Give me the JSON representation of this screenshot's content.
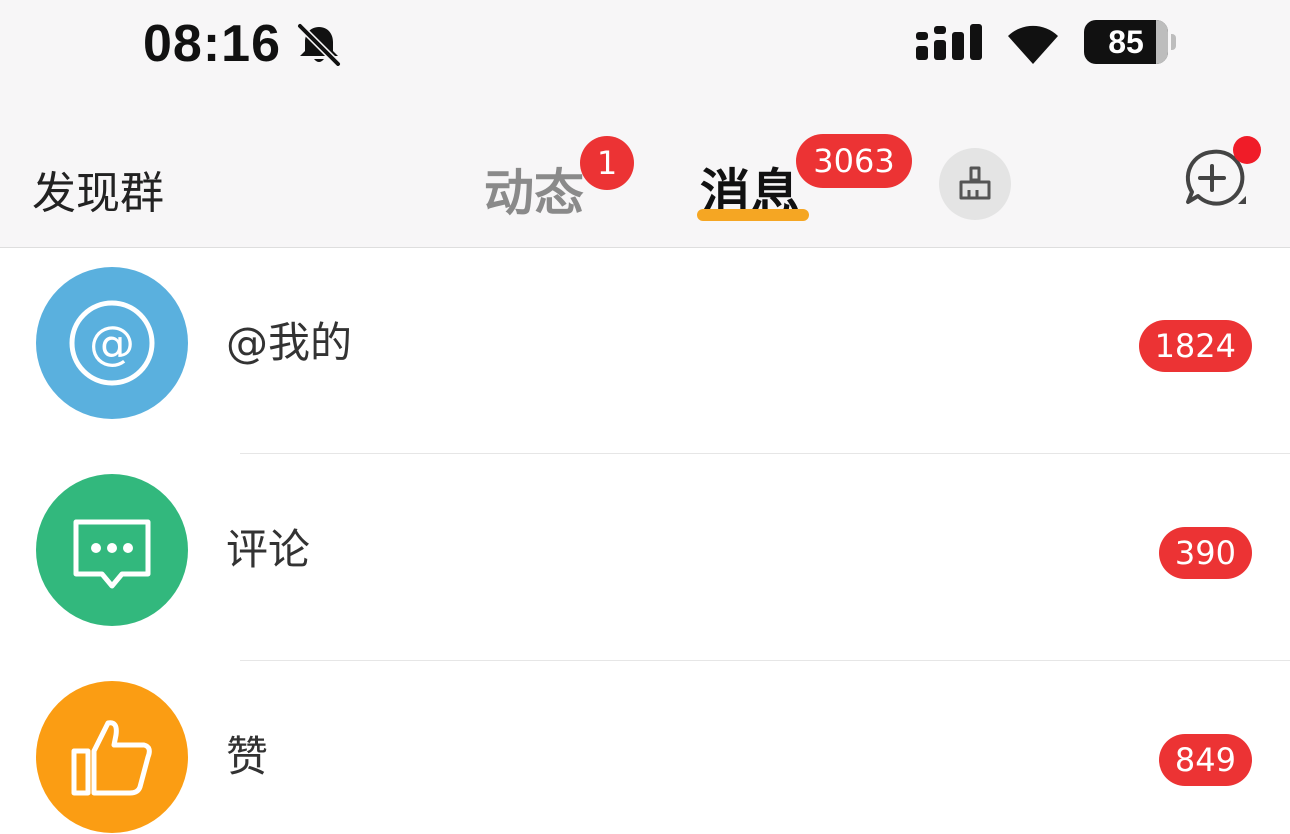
{
  "status_bar": {
    "time": "08:16",
    "icons": [
      "bell-slash-icon",
      "cellular-signal-icon",
      "wifi-icon",
      "battery-icon"
    ],
    "battery_level": "85"
  },
  "nav": {
    "left_label": "发现群",
    "tabs": [
      {
        "label": "动态",
        "badge": "1",
        "active": false
      },
      {
        "label": "消息",
        "badge": "3063",
        "active": true
      }
    ],
    "icons": [
      "broom-icon",
      "compose-chat-icon"
    ],
    "accent_color": "#f5a623",
    "badge_color": "#ec3334"
  },
  "messages": [
    {
      "label": "@我的",
      "count": "1824",
      "icon": "at-icon",
      "color": "#5ab0de"
    },
    {
      "label": "评论",
      "count": "390",
      "icon": "comment-icon",
      "color": "#32b87d"
    },
    {
      "label": "赞",
      "count": "849",
      "icon": "thumbs-up-icon",
      "color": "#fb9d13"
    }
  ]
}
